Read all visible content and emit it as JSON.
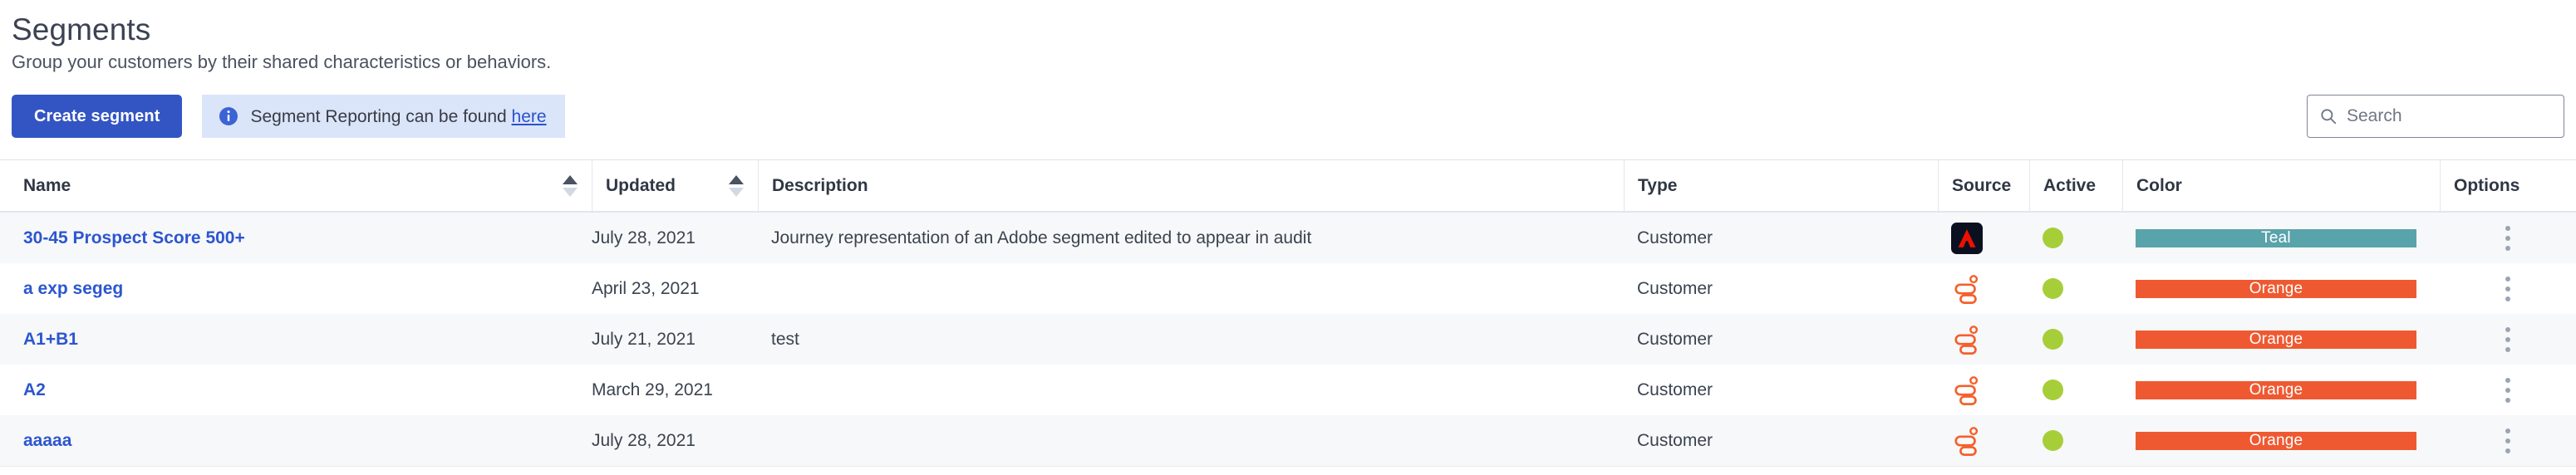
{
  "header": {
    "title": "Segments",
    "subtitle": "Group your customers by their shared characteristics or behaviors."
  },
  "toolbar": {
    "create_label": "Create segment",
    "info_icon": "info-circle-icon",
    "info_text": "Segment Reporting can be found ",
    "info_link_label": "here"
  },
  "search": {
    "icon": "search-icon",
    "placeholder": "Search",
    "value": ""
  },
  "table": {
    "columns": [
      {
        "label": "Name",
        "sortable": true
      },
      {
        "label": "Updated",
        "sortable": true
      },
      {
        "label": "Description",
        "sortable": false
      },
      {
        "label": "Type",
        "sortable": false
      },
      {
        "label": "Source",
        "sortable": false
      },
      {
        "label": "Active",
        "sortable": false
      },
      {
        "label": "Color",
        "sortable": false
      },
      {
        "label": "Options",
        "sortable": false
      }
    ],
    "rows": [
      {
        "name": "30-45 Prospect Score 500+",
        "updated": "July 28, 2021",
        "description": "Journey representation of an Adobe segment edited to appear in audit",
        "type": "Customer",
        "source_icon": "adobe-logo-icon",
        "active": true,
        "color_label": "Teal",
        "color_hex": "#59a3ab",
        "options_icon": "kebab-menu-icon"
      },
      {
        "name": "a exp segeg",
        "updated": "April 23, 2021",
        "description": "",
        "type": "Customer",
        "source_icon": "braze-logo-icon",
        "active": true,
        "color_label": "Orange",
        "color_hex": "#ef5931",
        "options_icon": "kebab-menu-icon"
      },
      {
        "name": "A1+B1",
        "updated": "July 21, 2021",
        "description": "test",
        "type": "Customer",
        "source_icon": "braze-logo-icon",
        "active": true,
        "color_label": "Orange",
        "color_hex": "#ef5931",
        "options_icon": "kebab-menu-icon"
      },
      {
        "name": "A2",
        "updated": "March 29, 2021",
        "description": "",
        "type": "Customer",
        "source_icon": "braze-logo-icon",
        "active": true,
        "color_label": "Orange",
        "color_hex": "#ef5931",
        "options_icon": "kebab-menu-icon"
      },
      {
        "name": "aaaaa",
        "updated": "July 28, 2021",
        "description": "",
        "type": "Customer",
        "source_icon": "braze-logo-icon",
        "active": true,
        "color_label": "Orange",
        "color_hex": "#ef5931",
        "options_icon": "kebab-menu-icon"
      }
    ]
  },
  "colors": {
    "primary_button": "#3355c4",
    "link": "#2c56d0",
    "info_banner_bg": "#dbe5f9",
    "active_dot": "#a6ce39",
    "adobe_red": "#eb1000",
    "adobe_bg": "#0b1021",
    "braze_orange": "#f4602c"
  }
}
